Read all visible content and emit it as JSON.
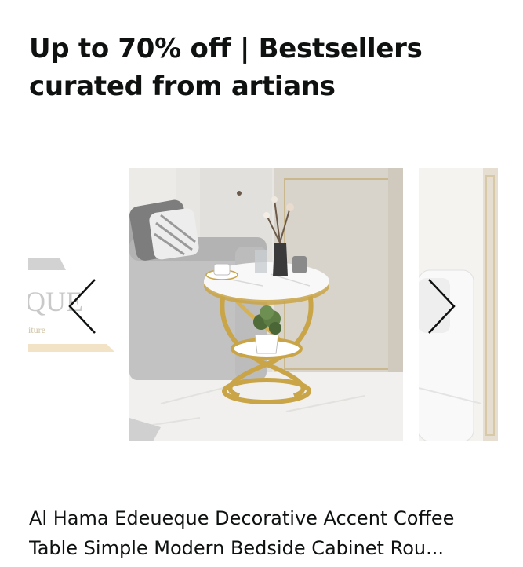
{
  "section": {
    "title": "Up to 70% off | Bestsellers curated from artians"
  },
  "carousel": {
    "prev_icon": "chevron-left-icon",
    "next_icon": "chevron-right-icon",
    "left_card": {
      "brand_text": "QUE",
      "brand_subtext": "iture"
    },
    "current_product": {
      "title": "Al Hama Edeueque Decorative Accent Coffee Table Simple Modern Bedside Cabinet Rou..."
    }
  }
}
